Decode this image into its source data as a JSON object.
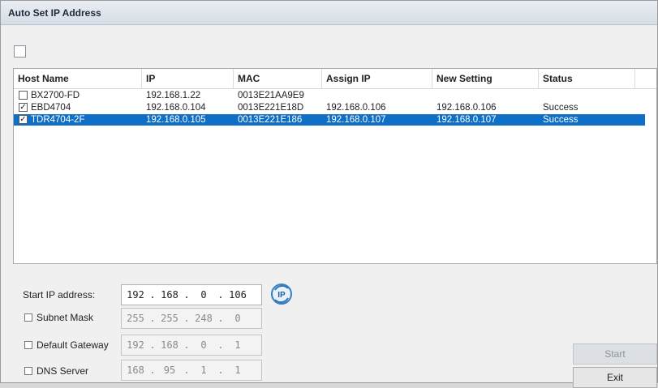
{
  "window": {
    "title": "Auto Set IP Address"
  },
  "table": {
    "headers": [
      "Host Name",
      "IP",
      "MAC",
      "Assign IP",
      "New Setting",
      "Status"
    ],
    "rows": [
      {
        "checked": false,
        "selected": false,
        "host": "BX2700-FD",
        "ip": "192.168.1.22",
        "mac": "0013E21AA9E9",
        "assign": "",
        "new": "",
        "status": ""
      },
      {
        "checked": true,
        "selected": false,
        "host": "EBD4704",
        "ip": "192.168.0.104",
        "mac": "0013E221E18D",
        "assign": "192.168.0.106",
        "new": "192.168.0.106",
        "status": "Success"
      },
      {
        "checked": true,
        "selected": true,
        "host": "TDR4704-2F",
        "ip": "192.168.0.105",
        "mac": "0013E221E186",
        "assign": "192.168.0.107",
        "new": "192.168.0.107",
        "status": "Success"
      }
    ]
  },
  "form": {
    "start_ip_label": "Start IP address:",
    "start_ip": [
      "192",
      "168",
      "0",
      "106"
    ],
    "subnet_label": "Subnet Mask",
    "subnet": [
      "255",
      "255",
      "248",
      "0"
    ],
    "gateway_label": "Default Gateway",
    "gateway": [
      "192",
      "168",
      "0",
      "1"
    ],
    "dns_label": "DNS Server",
    "dns": [
      "168",
      "95",
      "1",
      "1"
    ],
    "ip_button_icon": "ip-refresh-icon"
  },
  "buttons": {
    "start": "Start",
    "exit": "Exit"
  },
  "colors": {
    "selection": "#0f6fc6",
    "title_bg": "#dde3ea"
  }
}
